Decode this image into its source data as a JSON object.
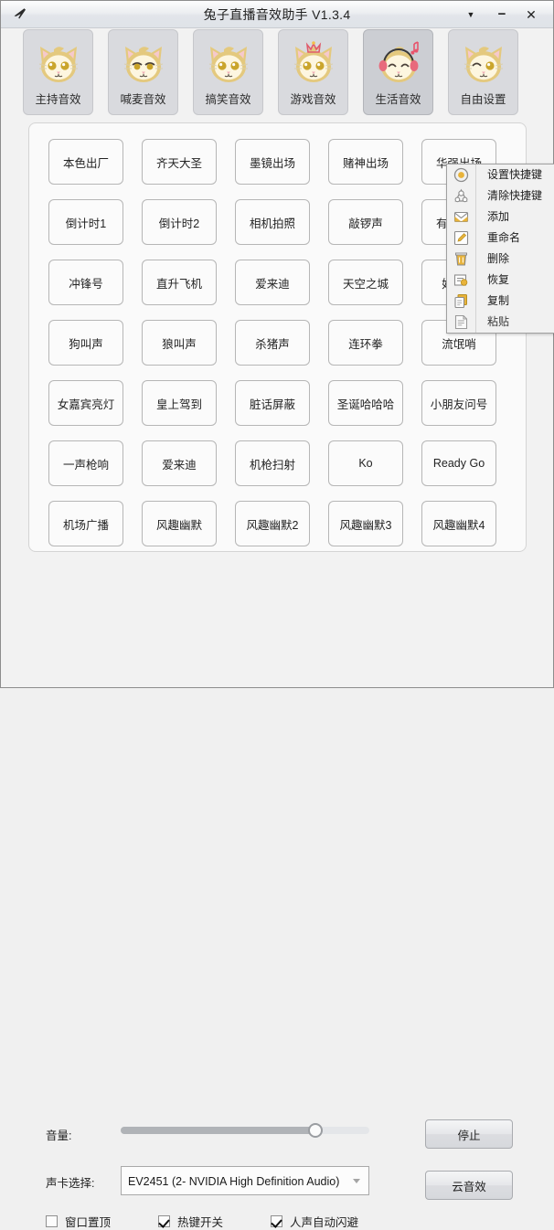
{
  "titlebar": {
    "title": "兔子直播音效助手 V1.3.4",
    "plane_icon": "airplane-pin-icon",
    "chevron": "▼",
    "minimize": "−",
    "close": "✕"
  },
  "tabs": [
    {
      "label": "主持音效",
      "icon": "cat-face-icon",
      "active": false
    },
    {
      "label": "喊麦音效",
      "icon": "cat-face-smirk-icon",
      "active": false
    },
    {
      "label": "搞笑音效",
      "icon": "cat-face-icon",
      "active": false
    },
    {
      "label": "游戏音效",
      "icon": "cat-face-crown-icon",
      "active": false
    },
    {
      "label": "生活音效",
      "icon": "cat-face-headphones-music-icon",
      "active": true
    },
    {
      "label": "自由设置",
      "icon": "cat-face-wink-icon",
      "active": false
    }
  ],
  "sound_buttons": [
    "本色出厂",
    "齐天大圣",
    "墨镜出场",
    "赌神出场",
    "华强出场",
    "倒计时1",
    "倒计时2",
    "相机拍照",
    "敲锣声",
    "有请主持",
    "冲锋号",
    "直升飞机",
    "爱来迪",
    "天空之城",
    "好日子",
    "狗叫声",
    "狼叫声",
    "杀猪声",
    "连环拳",
    "流氓哨",
    "女嘉宾亮灯",
    "皇上驾到",
    "脏话屏蔽",
    "圣诞哈哈哈",
    "小朋友问号",
    "一声枪响",
    "爱来迪",
    "机枪扫射",
    "Ko",
    "Ready Go",
    "机场广播",
    "风趣幽默",
    "风趣幽默2",
    "风趣幽默3",
    "风趣幽默4"
  ],
  "context_menu": [
    {
      "label": "设置快捷键",
      "icon": "target-ring-icon",
      "disabled": false
    },
    {
      "label": "清除快捷键",
      "icon": "clear-shape-icon",
      "disabled": false
    },
    {
      "label": "添加",
      "icon": "envelope-add-icon",
      "disabled": false
    },
    {
      "label": "重命名",
      "icon": "pencil-edit-icon",
      "disabled": false
    },
    {
      "label": "删除",
      "icon": "trash-can-icon",
      "disabled": false
    },
    {
      "label": "恢复",
      "icon": "restore-list-icon",
      "disabled": false
    },
    {
      "label": "复制",
      "icon": "copy-pages-icon",
      "disabled": false
    },
    {
      "label": "粘贴",
      "icon": "paste-page-icon",
      "disabled": true
    }
  ],
  "bottom": {
    "volume_label": "音量:",
    "volume_percent": 78,
    "soundcard_label": "声卡选择:",
    "soundcard_value": "EV2451 (2- NVIDIA High Definition Audio)",
    "stop_button": "停止",
    "cloud_button": "云音效",
    "checkboxes": [
      {
        "label": "窗口置顶",
        "checked": false
      },
      {
        "label": "热键开关",
        "checked": true
      },
      {
        "label": "人声自动闪避",
        "checked": true
      }
    ]
  },
  "colors": {
    "window_bg": "#f2f2f2",
    "tab_bg": "#d9dade",
    "tab_active_bg": "#ccced3",
    "icon_accent": "#e8b33a",
    "slider_fill": "#b0b3b7"
  }
}
